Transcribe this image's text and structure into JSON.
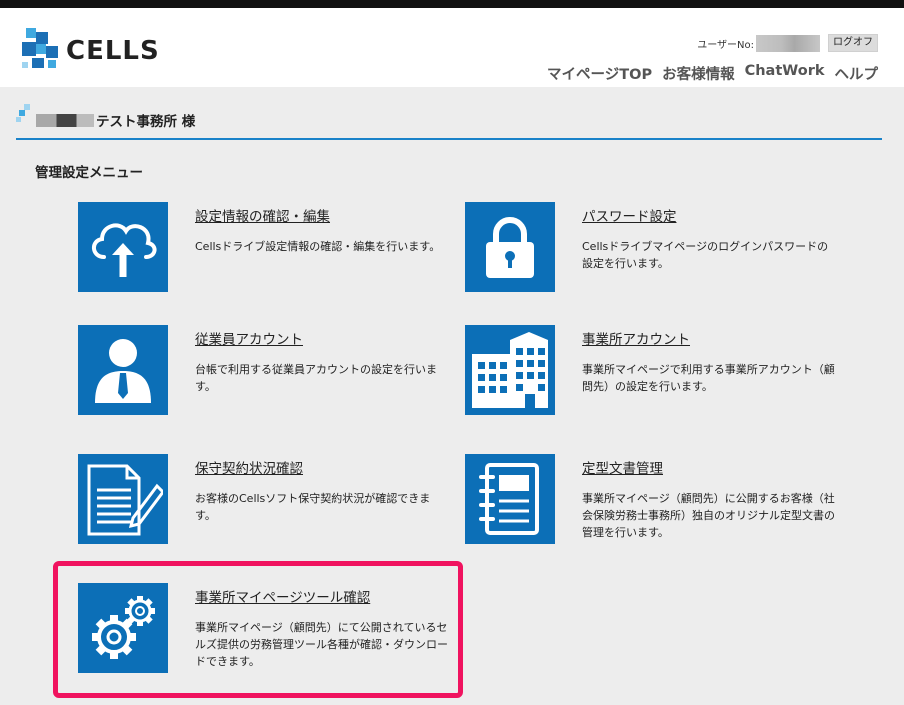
{
  "header": {
    "logo_text": "CELLS",
    "user_no_label": "ユーザーNo:",
    "logoff_label": "ログオフ",
    "nav": [
      "マイページTOP",
      "お客様情報",
      "ChatWork",
      "ヘルプ"
    ]
  },
  "account": {
    "name_suffix": "テスト事務所 様"
  },
  "section_title": "管理設定メニュー",
  "cards": [
    {
      "title": "設定情報の確認・編集",
      "desc": "Cellsドライブ設定情報の確認・編集を行います。",
      "icon": "cloud-upload-icon"
    },
    {
      "title": "パスワード設定",
      "desc": "Cellsドライブマイページのログインパスワードの設定を行います。",
      "icon": "lock-icon"
    },
    {
      "title": "従業員アカウント",
      "desc": "台帳で利用する従業員アカウントの設定を行います。",
      "icon": "employee-icon"
    },
    {
      "title": "事業所アカウント",
      "desc": "事業所マイページで利用する事業所アカウント（顧問先）の設定を行います。",
      "icon": "buildings-icon"
    },
    {
      "title": "保守契約状況確認",
      "desc": "お客様のCellsソフト保守契約状況が確認できます。",
      "icon": "document-pen-icon"
    },
    {
      "title": "定型文書管理",
      "desc": "事業所マイページ（顧問先）に公開するお客様（社会保険労務士事務所）独自のオリジナル定型文書の管理を行います。",
      "icon": "notebook-icon"
    },
    {
      "title": "事業所マイページツール確認",
      "desc": "事業所マイページ（顧問先）にて公開されているセルズ提供の労務管理ツール各種が確認・ダウンロードできます。",
      "icon": "gears-icon"
    }
  ],
  "colors": {
    "tile_blue": "#0c6fb7",
    "accent_line": "#1a82c9",
    "highlight_border": "#f0135f",
    "page_bg": "#ededed"
  }
}
